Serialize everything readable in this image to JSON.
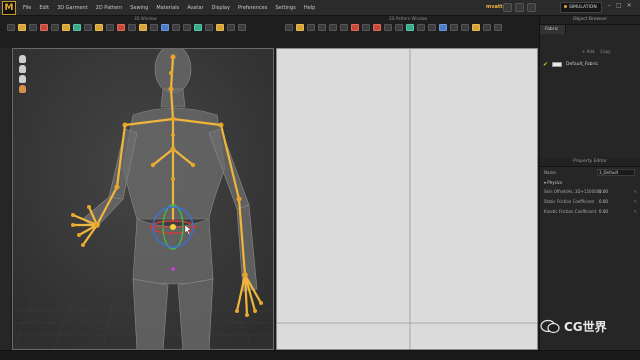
{
  "app": {
    "logo_letter": "M",
    "brand": "mvatto",
    "mode_label": "SIMULATION",
    "win_controls": [
      "–",
      "□",
      "✕"
    ]
  },
  "menu": [
    "File",
    "Edit",
    "3D Garment",
    "2D Pattern",
    "Sewing",
    "Materials",
    "Avatar",
    "Display",
    "Preferences",
    "Settings",
    "Help"
  ],
  "panes": {
    "left_title": "3D Window",
    "right_title": "2D Pattern Window"
  },
  "object_browser": {
    "title": "Object Browser",
    "tab": "Fabric",
    "add": "+ Add",
    "copy": "Copy",
    "fabric_name": "Default_Fabric",
    "swatch_color": "#e9e9e9"
  },
  "property_editor": {
    "title": "Property Editor",
    "name_label": "Name",
    "name_value": "3_Default",
    "physics_label": "Physics",
    "rows": [
      {
        "label": "Skin Offset(Hs, 3D+150000)",
        "value": "0.00"
      },
      {
        "label": "Static Friction Coefficient",
        "value": "0.00"
      },
      {
        "label": "Kinetic Friction Coefficient",
        "value": "0.00"
      }
    ]
  },
  "watermark": {
    "text": "CG世界"
  },
  "colors": {
    "accent": "#e4a62f",
    "joint": "#e8a62a",
    "bone": "#f1b53a",
    "viewport3d": "#3a3a3b",
    "viewport2d": "#dadada"
  }
}
